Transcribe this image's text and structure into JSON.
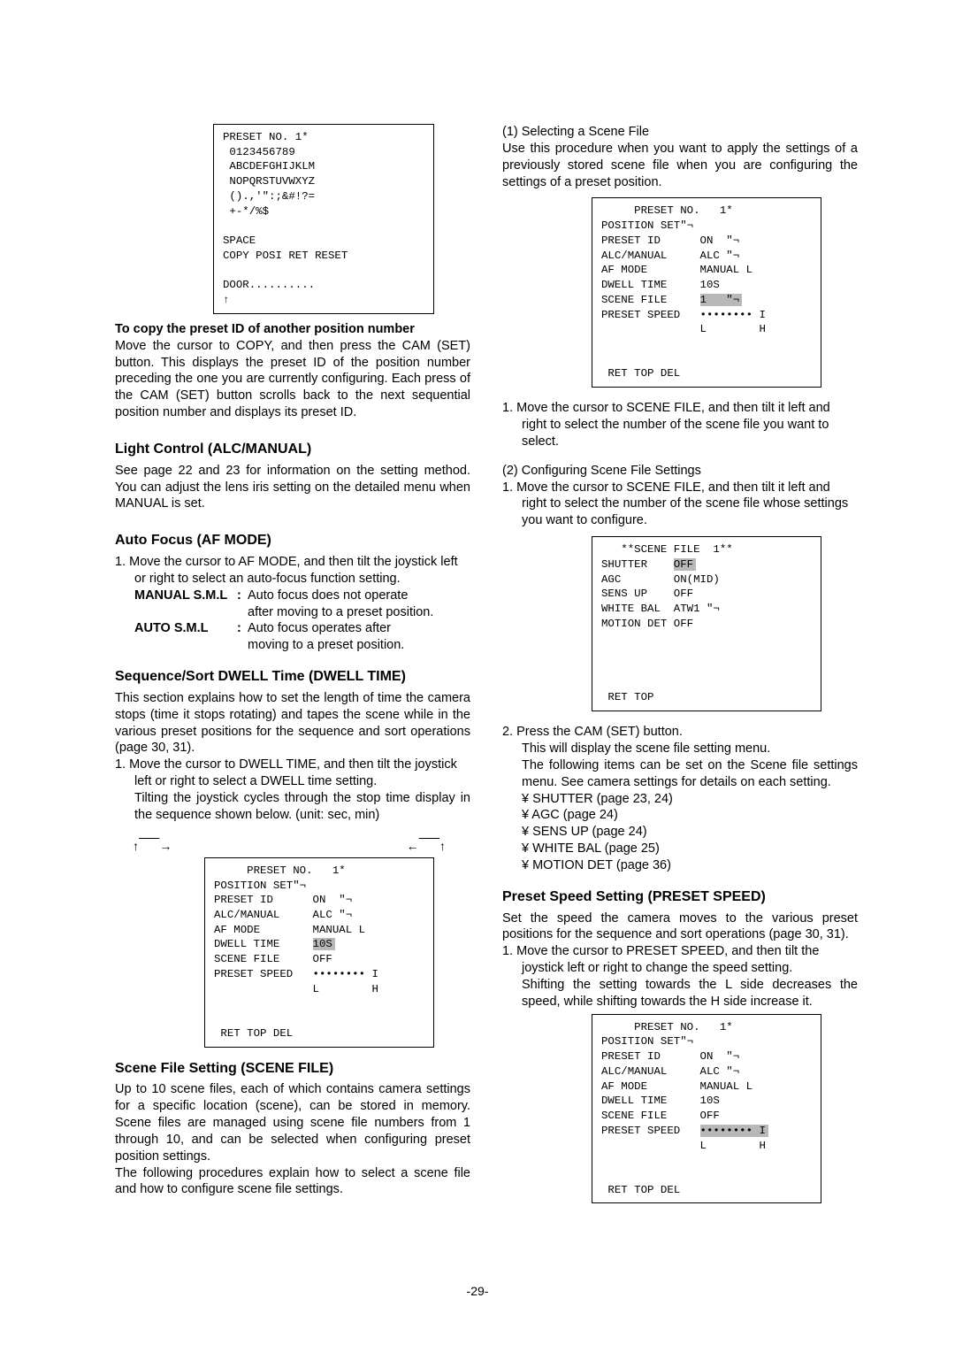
{
  "pageNumber": "-29-",
  "left": {
    "screen1_lines": "PRESET NO. 1*\n 0123456789\n ABCDEFGHIJKLM\n NOPQRSTUVWXYZ\n ().,'\":;&#!?=\n +-*/%$\n\nSPACE\nCOPY POSI RET RESET\n\nDOOR..........",
    "screen1_up": "↑",
    "copy_heading": "To copy the preset ID of another position number",
    "copy_para": "Move the cursor to COPY, and then press the CAM (SET) button. This displays the preset ID of the position number preceding the one you are currently configuring. Each press of the CAM (SET) button scrolls back to the next sequential position number and displays its preset ID.",
    "h_light": "Light Control (ALC/MANUAL)",
    "light_para": "See page 22 and 23 for information on the setting method. You can adjust the lens iris setting on the detailed menu when MANUAL is set.",
    "h_af": "Auto Focus (AF MODE)",
    "af_1": "Move the cursor to AF MODE, and then tilt the joystick left or right to select an auto-focus function setting.",
    "af_manual_label": "MANUAL S.M.L",
    "af_manual_val1": "Auto focus does not operate",
    "af_manual_val2": "after moving to a preset position.",
    "af_auto_label": "AUTO S.M.L",
    "af_auto_val1": "Auto focus operates after",
    "af_auto_val2": "moving to a preset position.",
    "h_dwell": "Sequence/Sort DWELL Time (DWELL TIME)",
    "dwell_para": "This section explains how to set the length of time the camera stops (time it stops rotating) and tapes the scene while in the various preset positions for the sequence and sort operations (page 30, 31).",
    "dwell_1a": "Move the cursor to DWELL TIME, and then tilt the joystick left or right to select a DWELL time setting.",
    "dwell_1b": "Tilting the joystick cycles through the stop time display in the sequence shown below. (unit: sec, min)",
    "screen2_pre": "     PRESET NO.   1*\nPOSITION SET\"¬\nPRESET ID      ON  \"¬\nALC/MANUAL     ALC \"¬\nAF MODE        MANUAL L\nDWELL TIME     ",
    "screen2_hl": "10S",
    "screen2_post": "\nSCENE FILE     OFF\nPRESET SPEED   •••••••• I\n               L        H\n\n\n RET TOP DEL",
    "h_scene": "Scene File Setting (SCENE FILE)",
    "scene_para1": "Up to 10 scene files, each of which contains camera settings for a specific location (scene), can be stored in memory. Scene files are managed using scene file numbers from 1 through 10, and can be selected when configuring preset position settings.",
    "scene_para2": "The following procedures explain how to select a scene file and how to configure scene file settings."
  },
  "right": {
    "sel_heading": "(1) Selecting a Scene File",
    "sel_para": "Use this procedure when you want to apply the settings of a previously stored scene file when you are configuring the settings of a preset position.",
    "screen3_pre": "     PRESET NO.   1*\nPOSITION SET\"¬\nPRESET ID      ON  \"¬\nALC/MANUAL     ALC \"¬\nAF MODE        MANUAL L\nDWELL TIME     10S\nSCENE FILE     ",
    "screen3_hl": "1   \"¬",
    "screen3_post": "\nPRESET SPEED   •••••••• I\n               L        H\n\n\n RET TOP DEL",
    "sel_1": "Move the cursor to SCENE FILE, and then tilt it left and right to select the number of the scene file you want to select.",
    "cfg_heading": "(2) Configuring Scene File Settings",
    "cfg_1": "Move the cursor to SCENE FILE, and then tilt it left and right to select the number of the scene file whose settings you want to configure.",
    "screen4_pre": "   **SCENE FILE  1**\nSHUTTER    ",
    "screen4_hl": "OFF",
    "screen4_post": "\nAGC        ON(MID)\nSENS UP    OFF\nWHITE BAL  ATW1 \"¬\nMOTION DET OFF\n\n\n\n\n RET TOP",
    "cfg_2_a": "Press the CAM (SET) button.",
    "cfg_2_b": "This will display the scene file setting menu.",
    "cfg_2_c": "The following items can be set on the Scene file settings menu. See camera settings for details on each setting.",
    "bul1": "SHUTTER (page 23, 24)",
    "bul2": "AGC (page 24)",
    "bul3": "SENS UP (page 24)",
    "bul4": "WHITE BAL (page 25)",
    "bul5": "MOTION DET (page 36)",
    "h_preset": "Preset Speed Setting (PRESET SPEED)",
    "preset_para": "Set the speed the camera moves to the various preset positions for the sequence and sort operations (page 30, 31).",
    "preset_1a": "Move the cursor to PRESET SPEED, and then tilt the joystick left or right to change the speed setting.",
    "preset_1b": "Shifting the setting towards the L side decreases the speed, while shifting towards the H side increase it.",
    "screen5_pre": "     PRESET NO.   1*\nPOSITION SET\"¬\nPRESET ID      ON  \"¬\nALC/MANUAL     ALC \"¬\nAF MODE        MANUAL L\nDWELL TIME     10S\nSCENE FILE     OFF\nPRESET SPEED   ",
    "screen5_hl": "•••••••• I",
    "screen5_post": "\n               L        H\n\n\n RET TOP DEL"
  }
}
